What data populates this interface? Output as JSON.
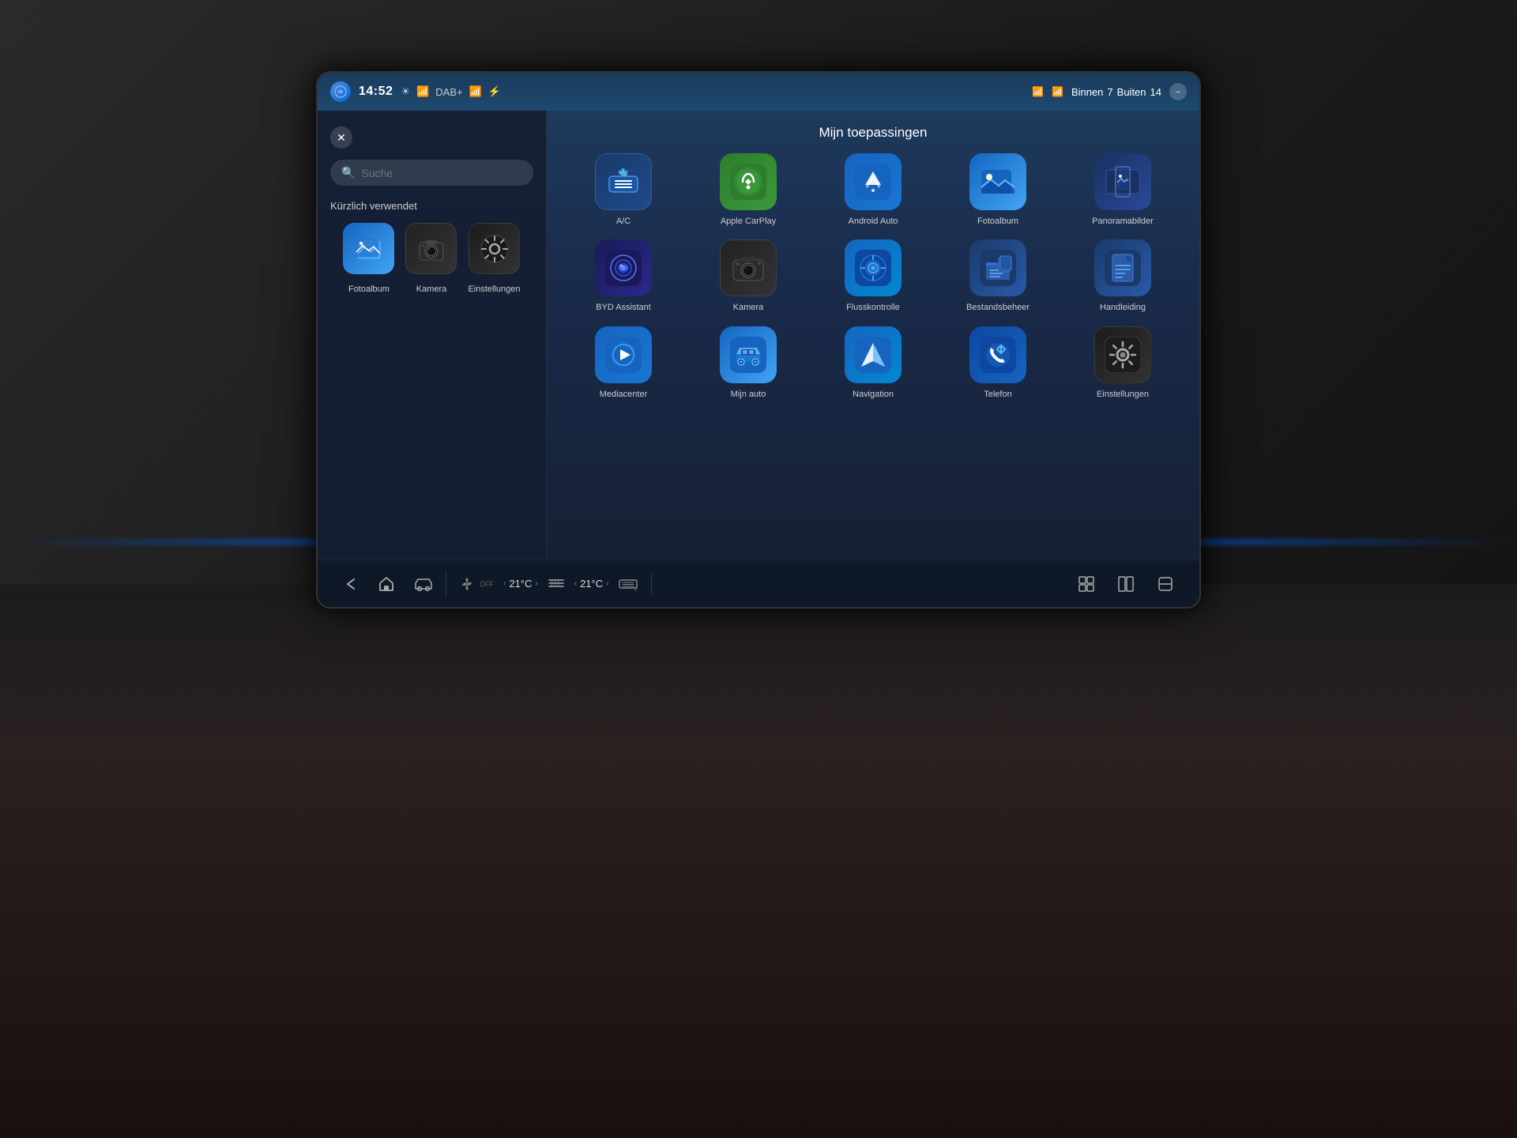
{
  "screen": {
    "status_bar": {
      "time": "14:52",
      "signal": "DAB+",
      "weather_inside_label": "Binnen",
      "weather_inside_temp": "7",
      "weather_outside_label": "Buiten",
      "weather_outside_temp": "14"
    },
    "search": {
      "placeholder": "Suche"
    },
    "recently_used_label": "Kürzlich verwendet",
    "main_title": "Mijn toepassingen",
    "recent_apps": [
      {
        "id": "fotoalbum-recent",
        "label": "Fotoalbum",
        "icon_type": "photos"
      },
      {
        "id": "kamera-recent",
        "label": "Kamera",
        "icon_type": "camera"
      },
      {
        "id": "einstellungen-recent",
        "label": "Einstellungen",
        "icon_type": "settings"
      }
    ],
    "apps": [
      {
        "id": "ac",
        "label": "A/C",
        "icon_type": "ac"
      },
      {
        "id": "carplay",
        "label": "Apple CarPlay",
        "icon_type": "carplay"
      },
      {
        "id": "android-auto",
        "label": "Android Auto",
        "icon_type": "android"
      },
      {
        "id": "fotoalbum",
        "label": "Fotoalbum",
        "icon_type": "photos"
      },
      {
        "id": "panorama",
        "label": "Panoramabilder",
        "icon_type": "panorama"
      },
      {
        "id": "byd-assistant",
        "label": "BYD Assistant",
        "icon_type": "byd"
      },
      {
        "id": "kamera",
        "label": "Kamera",
        "icon_type": "camera"
      },
      {
        "id": "flusskontrolle",
        "label": "Flusskontrolle",
        "icon_type": "flow"
      },
      {
        "id": "bestandsbeheer",
        "label": "Bestandsbeheer",
        "icon_type": "files"
      },
      {
        "id": "handleiding",
        "label": "Handleiding",
        "icon_type": "manual"
      },
      {
        "id": "mediacenter",
        "label": "Mediacenter",
        "icon_type": "media"
      },
      {
        "id": "mijn-auto",
        "label": "Mijn auto",
        "icon_type": "mycar"
      },
      {
        "id": "navigation",
        "label": "Navigation",
        "icon_type": "nav"
      },
      {
        "id": "telefon",
        "label": "Telefon",
        "icon_type": "phone"
      },
      {
        "id": "einstellungen",
        "label": "Einstellungen",
        "icon_type": "settings"
      }
    ],
    "bottom_bar": {
      "fan_label": "OFF",
      "temp_left": "21°C",
      "temp_right": "21°C",
      "rear_label": "F"
    }
  },
  "icons": {
    "ac_symbol": "❄",
    "carplay_symbol": "▶",
    "android_symbol": "▲",
    "photos_symbol": "🏔",
    "panorama_symbol": "🏔",
    "byd_symbol": "◉",
    "camera_symbol": "📷",
    "flow_symbol": "◉",
    "files_symbol": "📁",
    "manual_symbol": "📄",
    "media_symbol": "▶",
    "mycar_symbol": "🚗",
    "nav_symbol": "▲",
    "phone_symbol": "📞",
    "settings_symbol": "⚙",
    "search_symbol": "🔍",
    "close_symbol": "✕",
    "back_symbol": "←",
    "home_symbol": "⌂",
    "car_dash_symbol": "🚗",
    "grid_symbol": "⊞",
    "split_symbol": "⊟",
    "switch_symbol": "⇄"
  }
}
